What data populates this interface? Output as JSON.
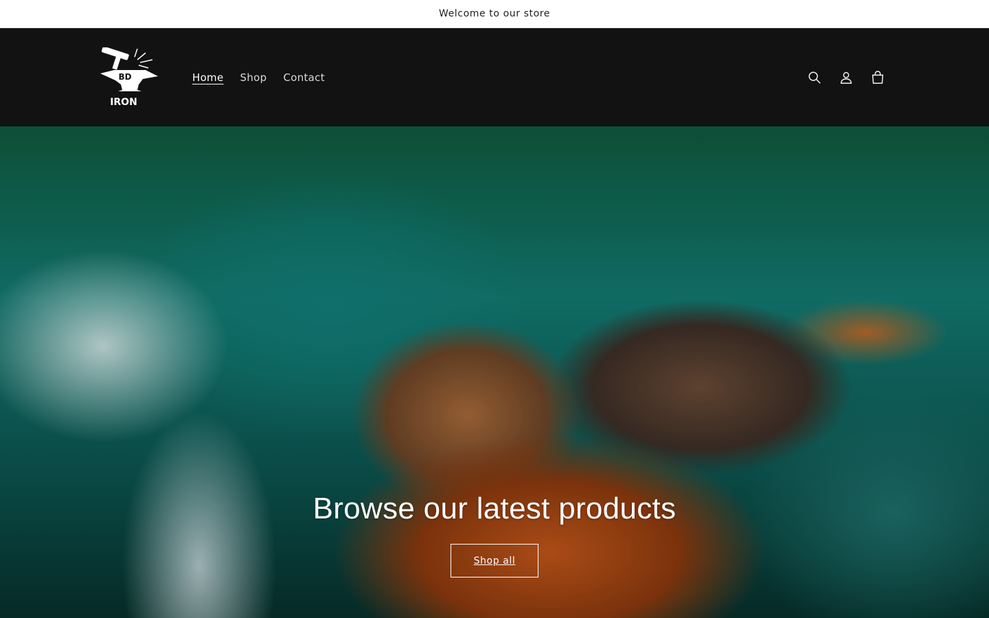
{
  "announcement": {
    "text": "Welcome to our store"
  },
  "header": {
    "logo": {
      "line1": "BD",
      "line2": "IRON",
      "icon": "anvil-hammer-logo"
    },
    "nav": [
      {
        "label": "Home",
        "active": true
      },
      {
        "label": "Shop",
        "active": false
      },
      {
        "label": "Contact",
        "active": false
      }
    ],
    "icons": [
      "search-icon",
      "account-icon",
      "cart-icon"
    ]
  },
  "hero": {
    "title": "Browse our latest products",
    "button_label": "Shop all"
  },
  "colors": {
    "header_bg": "#121212",
    "announcement_bg": "#ffffff",
    "hero_text": "#ffffff"
  }
}
